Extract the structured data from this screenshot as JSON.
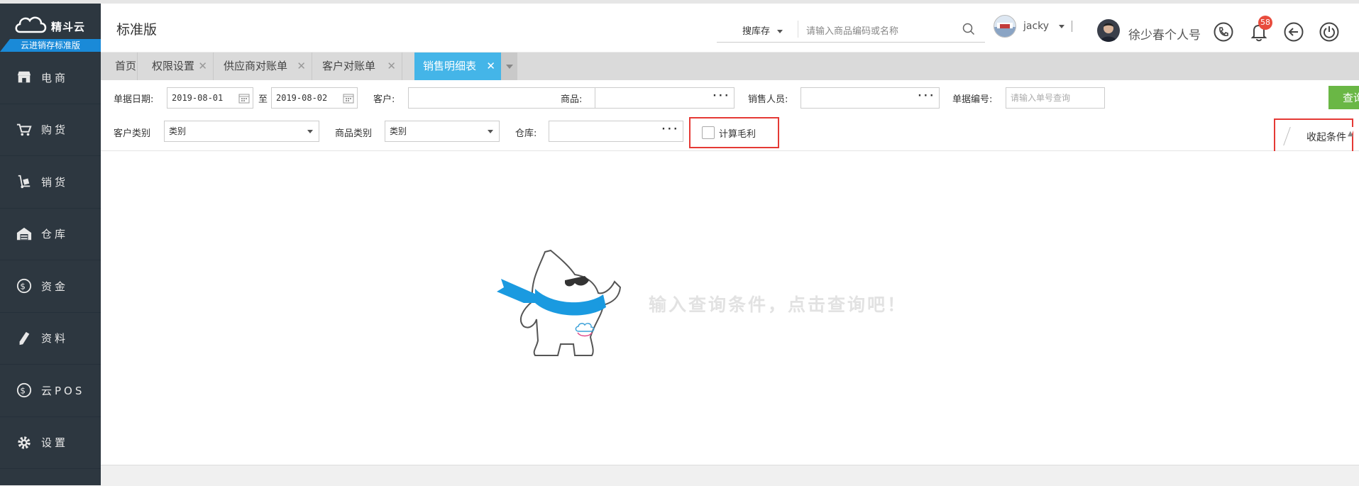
{
  "app": {
    "brand": "精斗云",
    "edition": "云进销存标准版",
    "page_title": "标准版"
  },
  "sidebar": {
    "items": [
      {
        "label": "电商",
        "icon": "store-icon"
      },
      {
        "label": "购货",
        "icon": "cart-icon"
      },
      {
        "label": "销货",
        "icon": "hand-truck-icon"
      },
      {
        "label": "仓库",
        "icon": "warehouse-icon"
      },
      {
        "label": "资金",
        "icon": "dollar-circle-icon"
      },
      {
        "label": "资料",
        "icon": "pencil-icon"
      },
      {
        "label": "云POS",
        "icon": "dollar-circle-icon"
      },
      {
        "label": "设置",
        "icon": "gear-icon"
      }
    ]
  },
  "header": {
    "search_category": "搜库存",
    "search_placeholder": "请输入商品编码或名称",
    "user_name": "jacky",
    "account_name": "徐少春个人号",
    "notification_count": "58"
  },
  "tabs": [
    {
      "label": "首页",
      "closable": false,
      "active": false
    },
    {
      "label": "权限设置",
      "closable": true,
      "active": false
    },
    {
      "label": "供应商对账单",
      "closable": true,
      "active": false
    },
    {
      "label": "客户对账单",
      "closable": true,
      "active": false
    },
    {
      "label": "销售明细表",
      "closable": true,
      "active": true
    }
  ],
  "filters": {
    "date_label": "单据日期:",
    "date_from": "2019-08-01",
    "date_to_label": "至",
    "date_to": "2019-08-02",
    "customer_label": "客户:",
    "customer_value": "",
    "product_label": "商品:",
    "product_value": "",
    "salesperson_label": "销售人员:",
    "salesperson_value": "",
    "doc_no_label": "单据编号:",
    "doc_no_placeholder": "请输入单号查询",
    "query_button": "查询",
    "customer_type_label": "客户类别",
    "customer_type_value": "类别",
    "product_type_label": "商品类别",
    "product_type_value": "类别",
    "warehouse_label": "仓库:",
    "warehouse_value": "",
    "gross_profit_label": "计算毛利",
    "gross_profit_checked": false,
    "collapse_label": "收起条件"
  },
  "content": {
    "empty_hint": "输入查询条件，点击查询吧！"
  },
  "colors": {
    "sidebar_bg": "#2d3740",
    "active_tab": "#44b5e8",
    "query_button": "#6ab745",
    "badge": "#e84c3d",
    "highlight_box": "#e53935"
  }
}
